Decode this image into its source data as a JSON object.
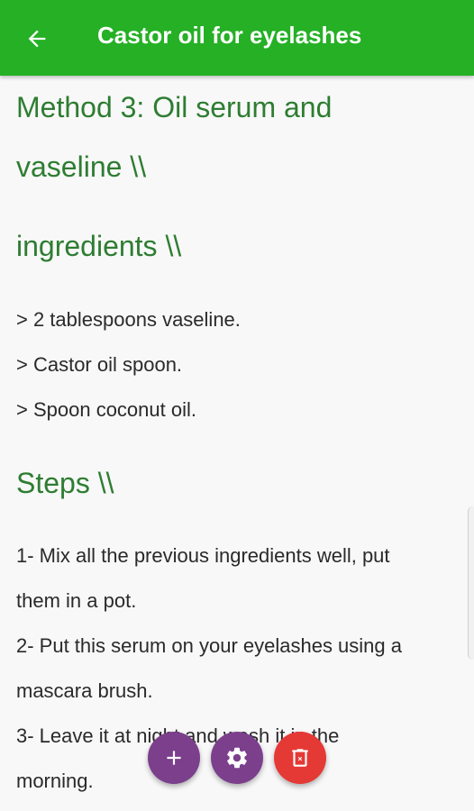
{
  "appbar": {
    "title": "Castor oil for eyelashes",
    "back_icon": "arrow-left-icon",
    "background": "#25b025"
  },
  "article": {
    "method_heading_line1": "Method 3: Oil serum and",
    "method_heading_line2": "vaseline \\\\",
    "ingredients_heading": "ingredients \\\\",
    "ingredients": [
      "> 2 tablespoons vaseline.",
      "> Castor oil spoon.",
      "> Spoon coconut oil."
    ],
    "steps_heading": "Steps \\\\",
    "steps_lines": [
      "1- Mix all the previous ingredients well, put",
      "them in a pot.",
      "2- Put this serum on your eyelashes using a",
      "mascara brush.",
      "3- Leave it at night and wash it in the",
      "morning."
    ],
    "heading_color": "#2e7d32"
  },
  "fabs": {
    "add_icon": "plus-icon",
    "settings_icon": "gear-icon",
    "delete_icon": "trash-icon",
    "add_color": "#7b3f8c",
    "delete_color": "#e53935"
  }
}
